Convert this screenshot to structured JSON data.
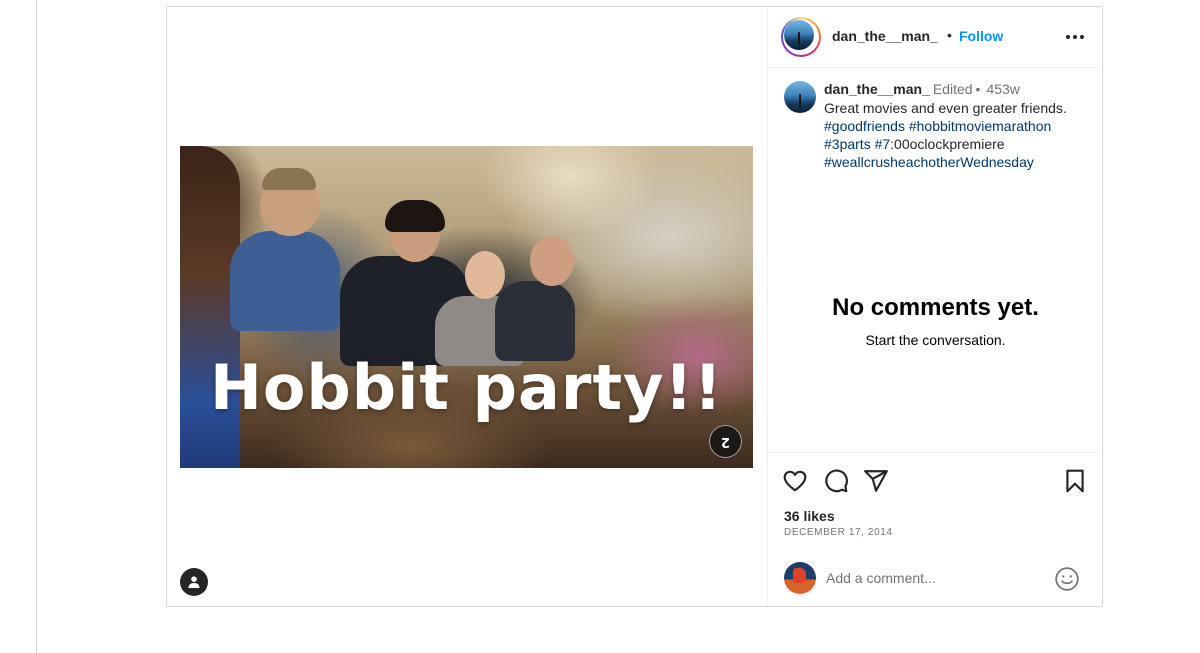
{
  "post": {
    "media": {
      "overlay_text": "Hobbit party!!",
      "carousel_count": "2"
    },
    "header": {
      "username": "dan_the__man_",
      "separator": "•",
      "follow_label": "Follow"
    },
    "caption": {
      "username": "dan_the__man_",
      "edited_label": "Edited",
      "separator": "•",
      "time_ago": "453w",
      "text": "Great movies and even greater friends.",
      "hashtags": [
        "#goodfriends",
        "#hobbitmoviemarathon",
        "#3parts",
        "#7"
      ],
      "trailing_text": ":00oclockpremiere",
      "last_hashtag": "#weallcrusheachotherWednesday"
    },
    "comments": {
      "empty_title": "No comments yet.",
      "empty_subtitle": "Start the conversation."
    },
    "engagement": {
      "likes": "36 likes",
      "date": "DECEMBER 17, 2014"
    },
    "comment_box": {
      "placeholder": "Add a comment..."
    }
  },
  "colors": {
    "follow_blue": "#0095f6",
    "hashtag_blue": "#00376b",
    "border": "#dbdbdb",
    "muted_text": "#737373"
  },
  "icons": [
    "user-tag-icon",
    "more-options-icon",
    "heart-icon",
    "comment-icon",
    "share-icon",
    "bookmark-icon",
    "emoji-icon"
  ]
}
